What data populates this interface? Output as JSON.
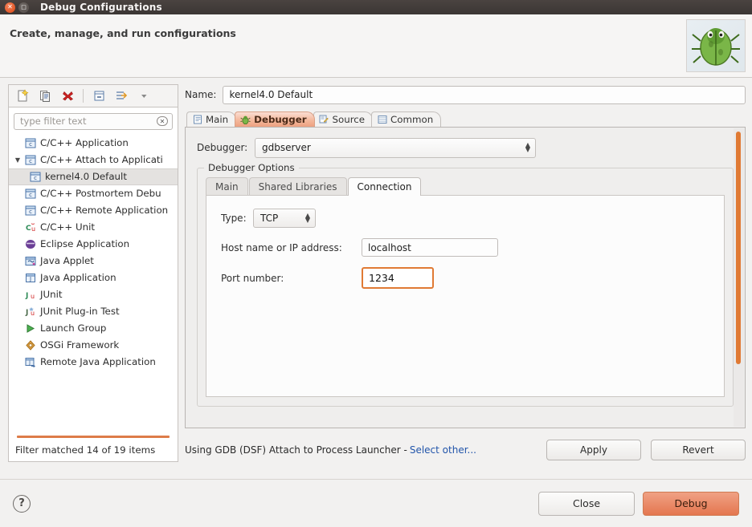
{
  "window": {
    "title": "Debug Configurations",
    "close_icon": "close-icon",
    "maximize_icon": "maximize-icon"
  },
  "header": {
    "title": "Create, manage, and run configurations",
    "banner_icon": "bug-illustration"
  },
  "sidebar": {
    "toolbar": [
      {
        "name": "new-configuration-button",
        "icon": "new-document-icon"
      },
      {
        "name": "duplicate-configuration-button",
        "icon": "copy-icon"
      },
      {
        "name": "delete-configuration-button",
        "icon": "delete-x-icon"
      },
      {
        "name": "collapse-all-button",
        "icon": "collapse-all-icon"
      },
      {
        "name": "filter-button",
        "icon": "filter-arrow-icon"
      },
      {
        "name": "view-menu-button",
        "icon": "chevron-down-icon"
      }
    ],
    "filter": {
      "placeholder": "type filter text",
      "value": "",
      "clear_icon": "clear-field-icon"
    },
    "items": [
      {
        "label": "C/C++ Application",
        "icon": "cpp-icon",
        "level": 0,
        "expandable": false,
        "selected": false
      },
      {
        "label": "C/C++ Attach to Applicati",
        "icon": "cpp-icon",
        "level": 0,
        "expandable": true,
        "expanded": true,
        "selected": false
      },
      {
        "label": "kernel4.0 Default",
        "icon": "cpp-config-icon",
        "level": 1,
        "expandable": false,
        "selected": true
      },
      {
        "label": "C/C++ Postmortem Debu",
        "icon": "cpp-icon",
        "level": 0,
        "expandable": false,
        "selected": false
      },
      {
        "label": "C/C++ Remote Application",
        "icon": "cpp-icon",
        "level": 0,
        "expandable": false,
        "selected": false
      },
      {
        "label": "C/C++ Unit",
        "icon": "cpp-unit-icon",
        "level": 0,
        "expandable": false,
        "selected": false
      },
      {
        "label": "Eclipse Application",
        "icon": "eclipse-icon",
        "level": 0,
        "expandable": false,
        "selected": false
      },
      {
        "label": "Java Applet",
        "icon": "java-applet-icon",
        "level": 0,
        "expandable": false,
        "selected": false
      },
      {
        "label": "Java Application",
        "icon": "java-application-icon",
        "level": 0,
        "expandable": false,
        "selected": false
      },
      {
        "label": "JUnit",
        "icon": "junit-icon",
        "level": 0,
        "expandable": false,
        "selected": false
      },
      {
        "label": "JUnit Plug-in Test",
        "icon": "junit-plugin-icon",
        "level": 0,
        "expandable": false,
        "selected": false
      },
      {
        "label": "Launch Group",
        "icon": "launch-group-icon",
        "level": 0,
        "expandable": false,
        "selected": false
      },
      {
        "label": "OSGi Framework",
        "icon": "osgi-icon",
        "level": 0,
        "expandable": false,
        "selected": false
      },
      {
        "label": "Remote Java Application",
        "icon": "remote-java-icon",
        "level": 0,
        "expandable": false,
        "selected": false
      }
    ],
    "filter_status": "Filter matched 14 of 19 items"
  },
  "main": {
    "name_label": "Name:",
    "name_value": "kernel4.0 Default",
    "tabs": [
      {
        "label": "Main",
        "icon": "document-icon",
        "active": false
      },
      {
        "label": "Debugger",
        "icon": "bug-icon",
        "active": true
      },
      {
        "label": "Source",
        "icon": "source-icon",
        "active": false
      },
      {
        "label": "Common",
        "icon": "common-icon",
        "active": false,
        "mnemonic": "C"
      }
    ],
    "debugger_label": "Debugger:",
    "debugger_value": "gdbserver",
    "group_title": "Debugger Options",
    "inner_tabs": [
      {
        "label": "Main",
        "active": false
      },
      {
        "label": "Shared Libraries",
        "active": false
      },
      {
        "label": "Connection",
        "active": true
      }
    ],
    "connection": {
      "type_label": "Type:",
      "type_value": "TCP",
      "host_label": "Host name or IP address:",
      "host_value": "localhost",
      "port_label": "Port number:",
      "port_value": "1234"
    },
    "launcher_text": "Using GDB (DSF) Attach to Process Launcher -",
    "launcher_link": "Select other...",
    "apply_label": "Apply",
    "revert_label": "Revert"
  },
  "footer": {
    "help_icon": "help-icon",
    "close_label": "Close",
    "debug_label": "Debug"
  },
  "colors": {
    "accent_orange": "#dd7c49",
    "scrollbar": "#e07a34",
    "link": "#2255aa",
    "titlebar": "#3b3634",
    "focus_border": "#e07a34"
  }
}
